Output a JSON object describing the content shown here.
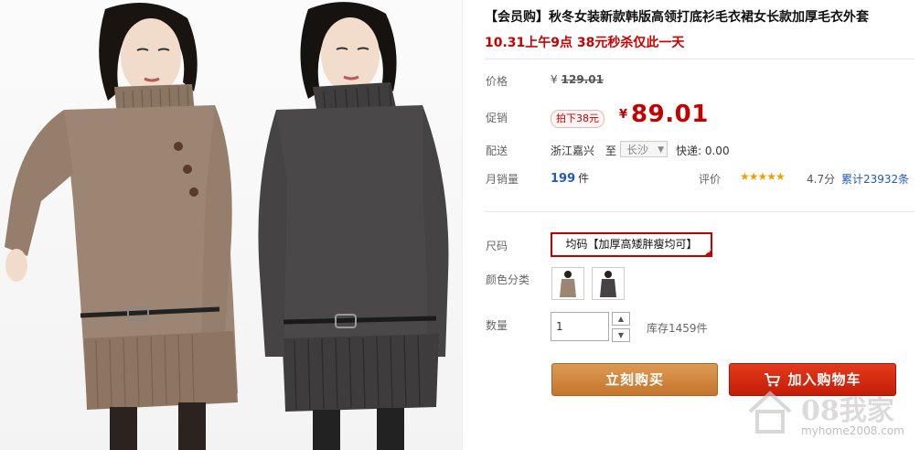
{
  "product": {
    "title": "【会员购】秋冬女装新款韩版高领打底衫毛衣裙女长款加厚毛衣外套",
    "subtitle": "10.31上午9点 38元秒杀仅此一天"
  },
  "price": {
    "label": "价格",
    "currency": "¥",
    "original": "129.01",
    "promo_label": "促销",
    "promo_tag": "拍下38元",
    "current": "89.01"
  },
  "delivery": {
    "label": "配送",
    "from": "浙江嘉兴",
    "to_word": "至",
    "city": "长沙",
    "express": "快递: 0.00"
  },
  "sales": {
    "label": "月销量",
    "count": "199",
    "unit": "件"
  },
  "rating": {
    "label": "评价",
    "stars": "★★★★★",
    "score": "4.7分",
    "reviews": "累计23932条"
  },
  "options": {
    "size_label": "尺码",
    "size_value": "均码【加厚高矮胖瘦均可】",
    "color_label": "颜色分类",
    "colors": [
      "brown-sweater",
      "charcoal-sweater"
    ]
  },
  "quantity": {
    "label": "数量",
    "value": "1",
    "up": "▲",
    "down": "▼",
    "stock": "库存1459件"
  },
  "buttons": {
    "buy_now": "立刻购买",
    "add_to_cart": "加入购物车"
  },
  "watermark": {
    "brand": "08我家",
    "url": "myhome2008.com"
  },
  "colors": {
    "price_red": "#c40000",
    "link_blue": "#205ac0",
    "buy_orange": "#c5752b",
    "cart_red": "#d92a12"
  }
}
